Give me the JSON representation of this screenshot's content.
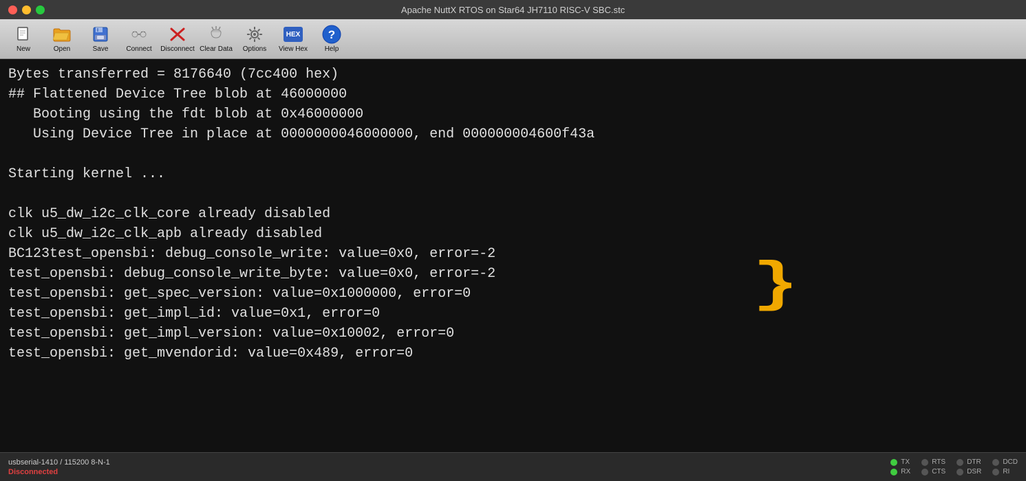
{
  "window": {
    "title": "Apache NuttX RTOS on Star64 JH7110 RISC-V SBC.stc"
  },
  "toolbar": {
    "items": [
      {
        "id": "new",
        "label": "New",
        "icon": "📄"
      },
      {
        "id": "open",
        "label": "Open",
        "icon": "📂"
      },
      {
        "id": "save",
        "label": "Save",
        "icon": "💾"
      },
      {
        "id": "connect",
        "label": "Connect",
        "icon": "🔌"
      },
      {
        "id": "disconnect",
        "label": "Disconnect",
        "icon": "✖"
      },
      {
        "id": "cleardata",
        "label": "Clear Data",
        "icon": "🧹"
      },
      {
        "id": "options",
        "label": "Options",
        "icon": "⚙"
      },
      {
        "id": "viewhex",
        "label": "View Hex",
        "icon": "HEX"
      },
      {
        "id": "help",
        "label": "Help",
        "icon": "?"
      }
    ]
  },
  "terminal": {
    "lines": [
      "Bytes transferred = 8176640 (7cc400 hex)",
      "## Flattened Device Tree blob at 46000000",
      "   Booting using the fdt blob at 0x46000000",
      "   Using Device Tree in place at 0000000046000000, end 000000004600f43a",
      "",
      "Starting kernel ...",
      "",
      "clk u5_dw_i2c_clk_core already disabled",
      "clk u5_dw_i2c_clk_apb already disabled",
      "BC123test_opensbi: debug_console_write: value=0x0, error=-2",
      "test_opensbi: debug_console_write_byte: value=0x0, error=-2",
      "test_opensbi: get_spec_version: value=0x1000000, error=0",
      "test_opensbi: get_impl_id: value=0x1, error=0",
      "test_opensbi: get_impl_version: value=0x10002, error=0",
      "test_opensbi: get_mvendorid: value=0x489, error=0"
    ]
  },
  "status": {
    "connection": "usbserial-1410 / 115200 8-N-1",
    "state": "Disconnected",
    "indicators": {
      "tx": "TX",
      "rx": "RX",
      "rts": "RTS",
      "cts": "CTS",
      "dtr": "DTR",
      "dsr": "DSR",
      "dcd": "DCD",
      "ri": "RI"
    }
  }
}
